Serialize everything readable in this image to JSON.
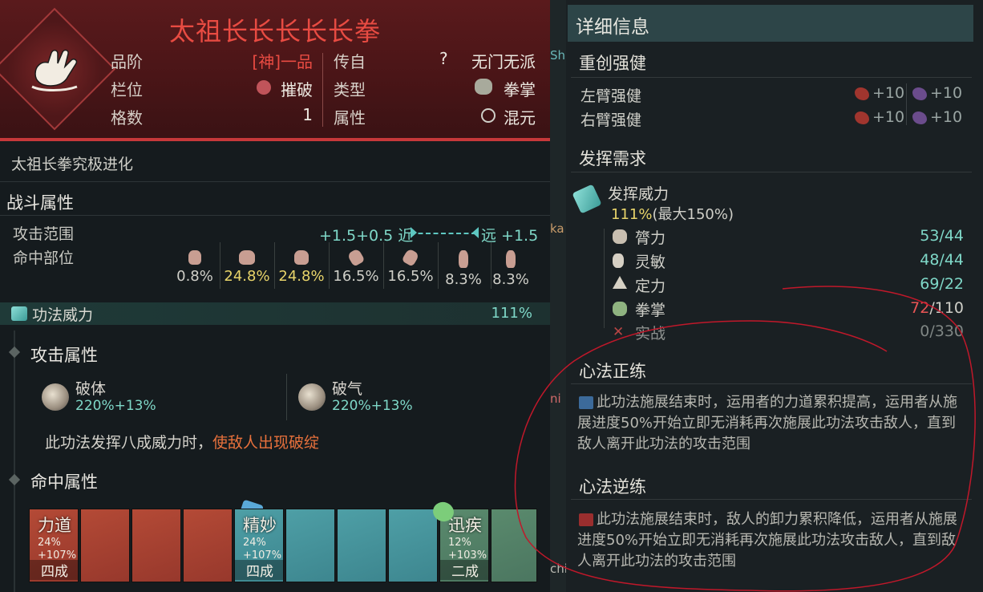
{
  "header": {
    "title": "太祖长长长长长拳",
    "rows": [
      {
        "label": "品阶",
        "value": "[神]一品",
        "label2": "传自",
        "value2": "无门无派",
        "icon2": "question-icon"
      },
      {
        "label": "栏位",
        "value": "摧破",
        "label2": "类型",
        "value2": "拳掌"
      },
      {
        "label": "格数",
        "value": "1",
        "label2": "属性",
        "value2": "混元"
      }
    ]
  },
  "subtitle": "太祖长拳究极进化",
  "combat": {
    "heading": "战斗属性",
    "range_label": "攻击范围",
    "range_value": "+1.5+0.5 近",
    "range_far": "远 +1.5",
    "hit_label": "命中部位",
    "hit_parts": [
      "0.8%",
      "24.8%",
      "24.8%",
      "16.5%",
      "16.5%",
      "8.3%",
      "8.3%"
    ]
  },
  "power": {
    "label": "功法威力",
    "value": "111%"
  },
  "attack": {
    "heading": "攻击属性",
    "items": [
      {
        "name": "破体",
        "value": "220%+13%"
      },
      {
        "name": "破气",
        "value": "220%+13%"
      }
    ],
    "note_prefix": "此功法发挥八成威力时，",
    "note_highlight": "使敌人出现破绽"
  },
  "hit": {
    "heading": "命中属性",
    "cards": [
      {
        "name": "力道",
        "pct": "24%",
        "bonus": "+107%",
        "rank": "四成",
        "color": "red"
      },
      {
        "name": "精妙",
        "pct": "24%",
        "bonus": "+107%",
        "rank": "四成",
        "color": "blue"
      },
      {
        "name": "迅疾",
        "pct": "12%",
        "bonus": "+103%",
        "rank": "二成",
        "color": "green"
      }
    ]
  },
  "mid_chips": [
    "Sh",
    "ka",
    "ni",
    "chi"
  ],
  "detail": {
    "title": "详细信息",
    "strong_heading": "重创强健",
    "strong_rows": [
      {
        "label": "左臂强健",
        "v1": "+10",
        "v2": "+10"
      },
      {
        "label": "右臂强健",
        "v1": "+10",
        "v2": "+10"
      }
    ],
    "req_heading": "发挥需求",
    "req_title": "发挥威力",
    "req_pct": "111%",
    "req_max": "(最大150%)",
    "stats": [
      {
        "name": "膂力",
        "value": "53/44"
      },
      {
        "name": "灵敏",
        "value": "48/44"
      },
      {
        "name": "定力",
        "value": "69/22"
      },
      {
        "name": "拳掌",
        "value_now": "72",
        "value_max": "/110"
      },
      {
        "name": "实战",
        "value": "0/330"
      }
    ],
    "zheng_heading": "心法正练",
    "zheng_text": "此功法施展结束时，运用者的力道累积提高，运用者从施展进度50%开始立即无消耗再次施展此功法攻击敌人，直到敌人离开此功法的攻击范围",
    "ni_heading": "心法逆练",
    "ni_text": "此功法施展结束时，敌人的卸力累积降低，运用者从施展进度50%开始立即无消耗再次施展此功法攻击敌人，直到敌人离开此功法的攻击范围"
  },
  "colors": {
    "accent_red": "#e84b42",
    "teal": "#7fd8c8",
    "yellow": "#e8d46a",
    "orange": "#e8713c"
  }
}
